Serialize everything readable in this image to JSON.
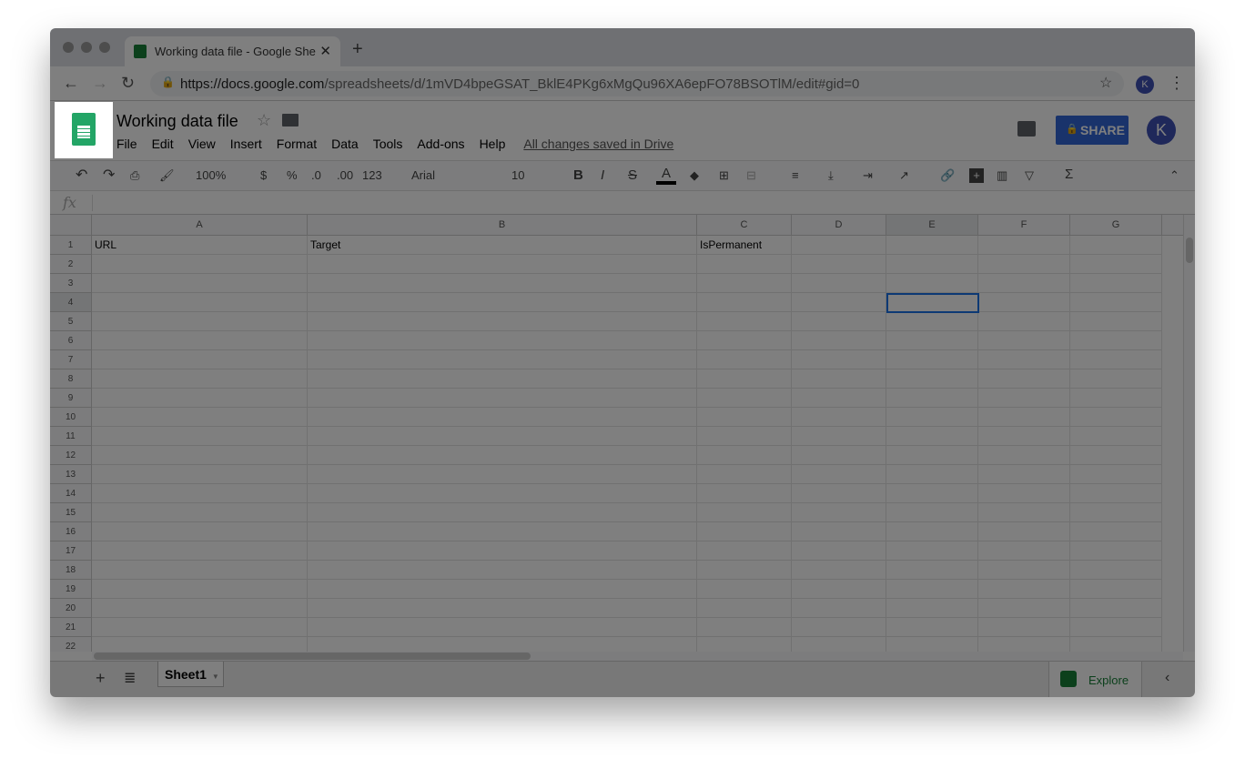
{
  "browser": {
    "tab_title": "Working data file - Google She",
    "url_host": "https://docs.google.com",
    "url_path": "/spreadsheets/d/1mVD4bpeGSAT_BklE4PKg6xMgQu96XA6epFO78BSOTlM/edit#gid=0",
    "profile_initial": "K"
  },
  "doc": {
    "title": "Working data file",
    "menus": [
      "File",
      "Edit",
      "View",
      "Insert",
      "Format",
      "Data",
      "Tools",
      "Add-ons",
      "Help"
    ],
    "save_status": "All changes saved in Drive",
    "share_label": "SHARE",
    "avatar_initial": "K"
  },
  "toolbar": {
    "zoom": "100%",
    "currency": "$",
    "percent": "%",
    "dec_less": ".0",
    "dec_more": ".00",
    "format": "123",
    "font": "Arial",
    "size": "10",
    "bold": "B",
    "italic": "I",
    "strike": "S",
    "text_color": "A",
    "sum": "Σ"
  },
  "formula": {
    "fx": "fx",
    "value": ""
  },
  "grid": {
    "columns": [
      "A",
      "B",
      "C",
      "D",
      "E",
      "F",
      "G"
    ],
    "rows": 22,
    "selected_cell": "E4",
    "cells": {
      "A1": "URL",
      "B1": "Target",
      "C1": "IsPermanent"
    }
  },
  "sheets": {
    "tabs": [
      "Sheet1"
    ],
    "explore_label": "Explore"
  },
  "colors": {
    "brand_green": "#188038",
    "share_blue": "#3367d6",
    "selection": "#1a73e8"
  }
}
